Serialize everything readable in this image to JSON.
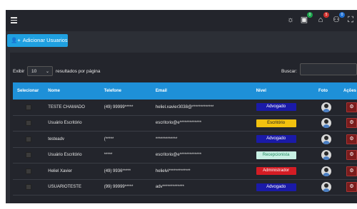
{
  "top_icons": {
    "badge1": "0",
    "badge2": "5",
    "badge3": "0",
    "badge1_color": "#1aa34a",
    "badge2_color": "#d0312d",
    "badge3_color": "#1f6fd1"
  },
  "toolbar": {
    "add_label": "Adicionar Usuarios"
  },
  "controls": {
    "show_label": "Exibir",
    "page_size": "10",
    "per_page_label": "resultados por página",
    "search_label": "Buscar:",
    "search_value": ""
  },
  "table": {
    "headers": [
      "Selecionar",
      "Nome",
      "Telefone",
      "Email",
      "Nível",
      "Foto",
      "Ações"
    ],
    "rows": [
      {
        "nome": "TESTE CHAMADO",
        "telefone": "(49) 99999*****",
        "email": "heliel.xavier3038@*************",
        "nivel": "Advogado",
        "nivel_bg": "#1a1aa8",
        "nivel_fg": "#ffffff"
      },
      {
        "nome": "Usuário Escritório",
        "telefone": "",
        "email": "escritorio@e*************",
        "nivel": "Escritório",
        "nivel_bg": "#f2c20f",
        "nivel_fg": "#222222"
      },
      {
        "nome": "testeadv",
        "telefone": "(*****",
        "email": "*************",
        "nivel": "Advogado",
        "nivel_bg": "#1a1aa8",
        "nivel_fg": "#ffffff"
      },
      {
        "nome": "Usuário Escritório",
        "telefone": "*****",
        "email": "escritorio@e*************",
        "nivel": "Recepcionista",
        "nivel_bg": "#c8f0e4",
        "nivel_fg": "#1f8a5e"
      },
      {
        "nome": "Heliel Xavier",
        "telefone": "(49) 9936*****",
        "email": "helielvi*************",
        "nivel": "Administrador",
        "nivel_bg": "#d41c24",
        "nivel_fg": "#ffffff"
      },
      {
        "nome": "USUARIOTESTE",
        "telefone": "(99) 99999*****",
        "email": "adv*************",
        "nivel": "Advogado",
        "nivel_bg": "#1a1aa8",
        "nivel_fg": "#ffffff"
      }
    ]
  }
}
